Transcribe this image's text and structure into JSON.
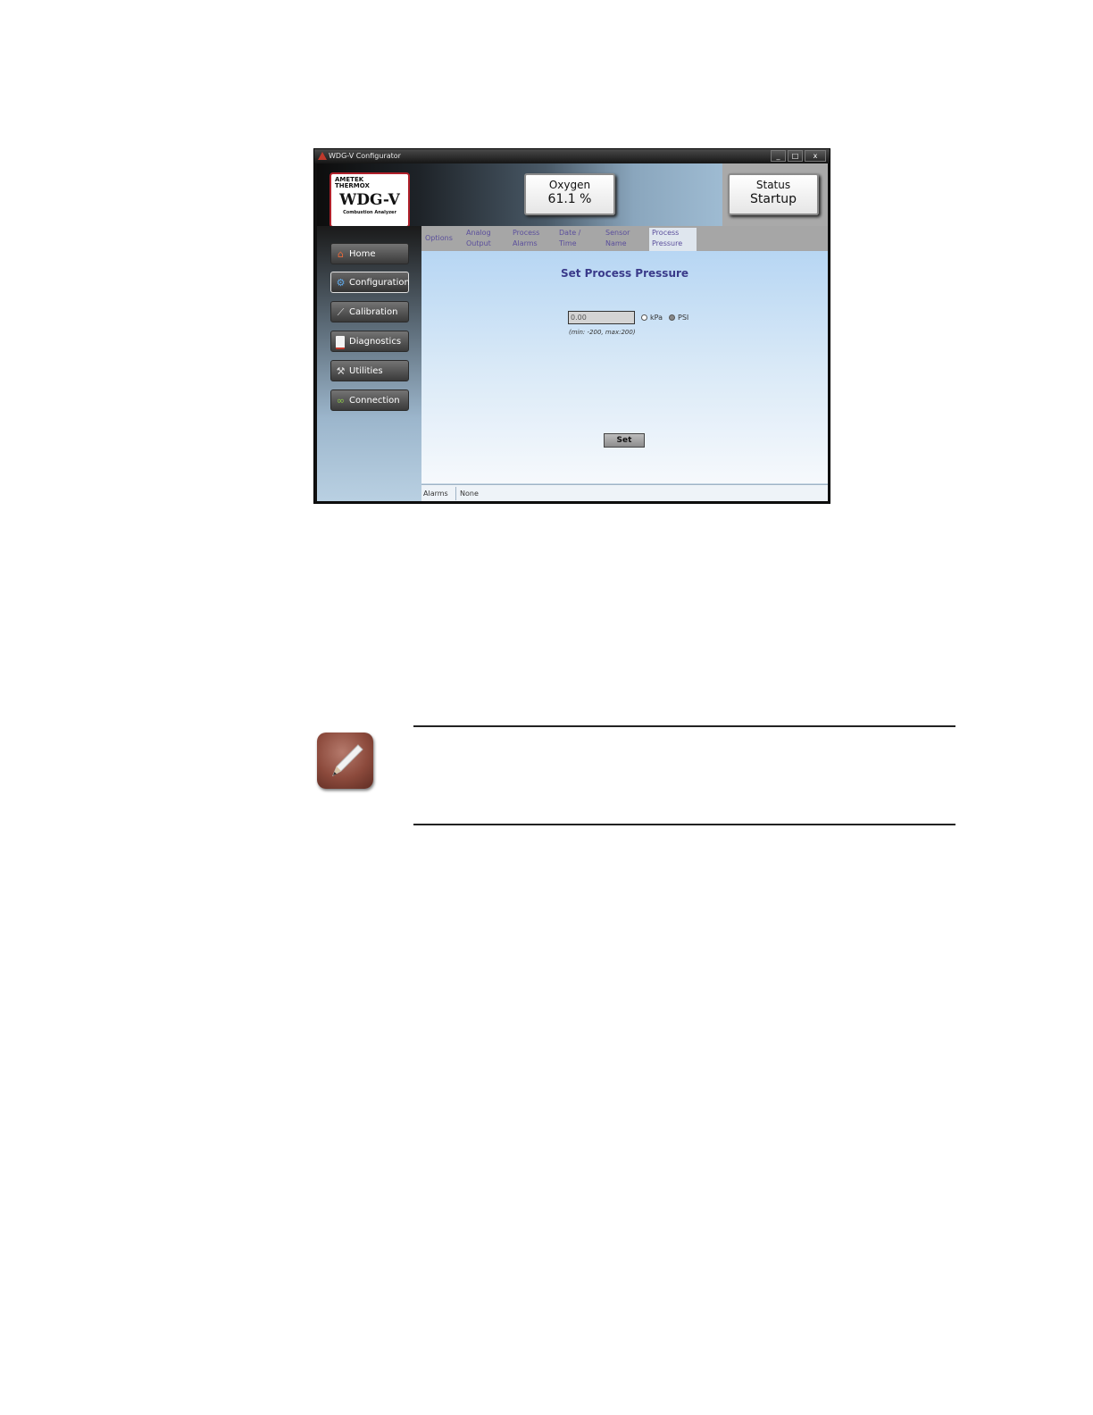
{
  "window": {
    "title": "WDG-V Configurator",
    "controls": [
      "_",
      "□",
      "x"
    ]
  },
  "brand": {
    "maker": [
      "AMETEK",
      "THERMOX"
    ],
    "model": "WDG-V",
    "subtitle": "Combustion Analyzer"
  },
  "readouts": {
    "oxygen": {
      "label": "Oxygen",
      "value": "61.1 %"
    },
    "status": {
      "label": "Status",
      "value": "Startup"
    }
  },
  "tabs": [
    {
      "line1": "Options",
      "line2": ""
    },
    {
      "line1": "Analog",
      "line2": "Output"
    },
    {
      "line1": "Process",
      "line2": "Alarms"
    },
    {
      "line1": "Date /",
      "line2": "Time"
    },
    {
      "line1": "Sensor",
      "line2": "Name"
    },
    {
      "line1": "Process",
      "line2": "Pressure"
    }
  ],
  "active_tab": "Process Pressure",
  "sidebar": {
    "items": [
      {
        "label": "Home",
        "icon": "home-icon"
      },
      {
        "label": "Configuration",
        "icon": "gear-icon"
      },
      {
        "label": "Calibration",
        "icon": "chart-icon"
      },
      {
        "label": "Diagnostics",
        "icon": "document-icon"
      },
      {
        "label": "Utilities",
        "icon": "wrench-icon"
      },
      {
        "label": "Connection",
        "icon": "link-icon"
      }
    ],
    "active": "Configuration"
  },
  "main": {
    "title": "Set Process Pressure",
    "pressure_value": "0.00",
    "units": [
      "kPa",
      "PSI"
    ],
    "selected_unit": "PSI",
    "range_hint": "(min: -200, max:200)",
    "set_label": "Set"
  },
  "statusbar": {
    "label": "Alarms",
    "value": "None"
  },
  "note": {
    "icon": "pencil-note-icon"
  },
  "colors": {
    "tab_text": "#5b4f9c",
    "title_text": "#3a3a8a",
    "brand_border": "#b0202a"
  }
}
